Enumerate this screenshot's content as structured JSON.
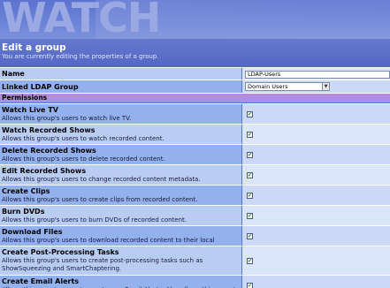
{
  "app": {
    "logo_text": "WATCH"
  },
  "header": {
    "title": "Edit a group",
    "subtitle": "You are currently editing the properties of a group."
  },
  "fields": {
    "name_label": "Name",
    "name_value": "LDAP-Users",
    "ldap_label": "Linked LDAP Group",
    "ldap_value": "Domain Users"
  },
  "permissions_label": "Permissions",
  "permissions": [
    {
      "name": "Watch Live TV",
      "desc": "Allows this group's users to watch live TV.",
      "checked": true
    },
    {
      "name": "Watch Recorded Shows",
      "desc": "Allows this group's users to watch recorded content.",
      "checked": true
    },
    {
      "name": "Delete Recorded Shows",
      "desc": "Allows this group's users to delete recorded content.",
      "checked": true
    },
    {
      "name": "Edit Recorded Shows",
      "desc": "Allows this group's users to change recorded content metadata.",
      "checked": true
    },
    {
      "name": "Create Clips",
      "desc": "Allows this group's users to create clips from recorded content.",
      "checked": true
    },
    {
      "name": "Burn DVDs",
      "desc": "Allows this group's users to burn DVDs of recorded content.",
      "checked": true
    },
    {
      "name": "Download Files",
      "desc": "Allows this group's users to download recorded content to their local machines.",
      "checked": true
    },
    {
      "name": "Create Post-Processing Tasks",
      "desc": "Allows this group's users to create post-processing tasks such as",
      "desc2": "ShowSqueezing and SmartChaptering.",
      "checked": true
    },
    {
      "name": "Create Email Alerts",
      "desc": "Allows this group's users to create new Email Alerts. Also allows this group's",
      "checked": true
    }
  ],
  "colors": {
    "perm_header": "#b48be3",
    "label_bg": "#93b1ec",
    "value_bg": "#cbd8f6"
  }
}
